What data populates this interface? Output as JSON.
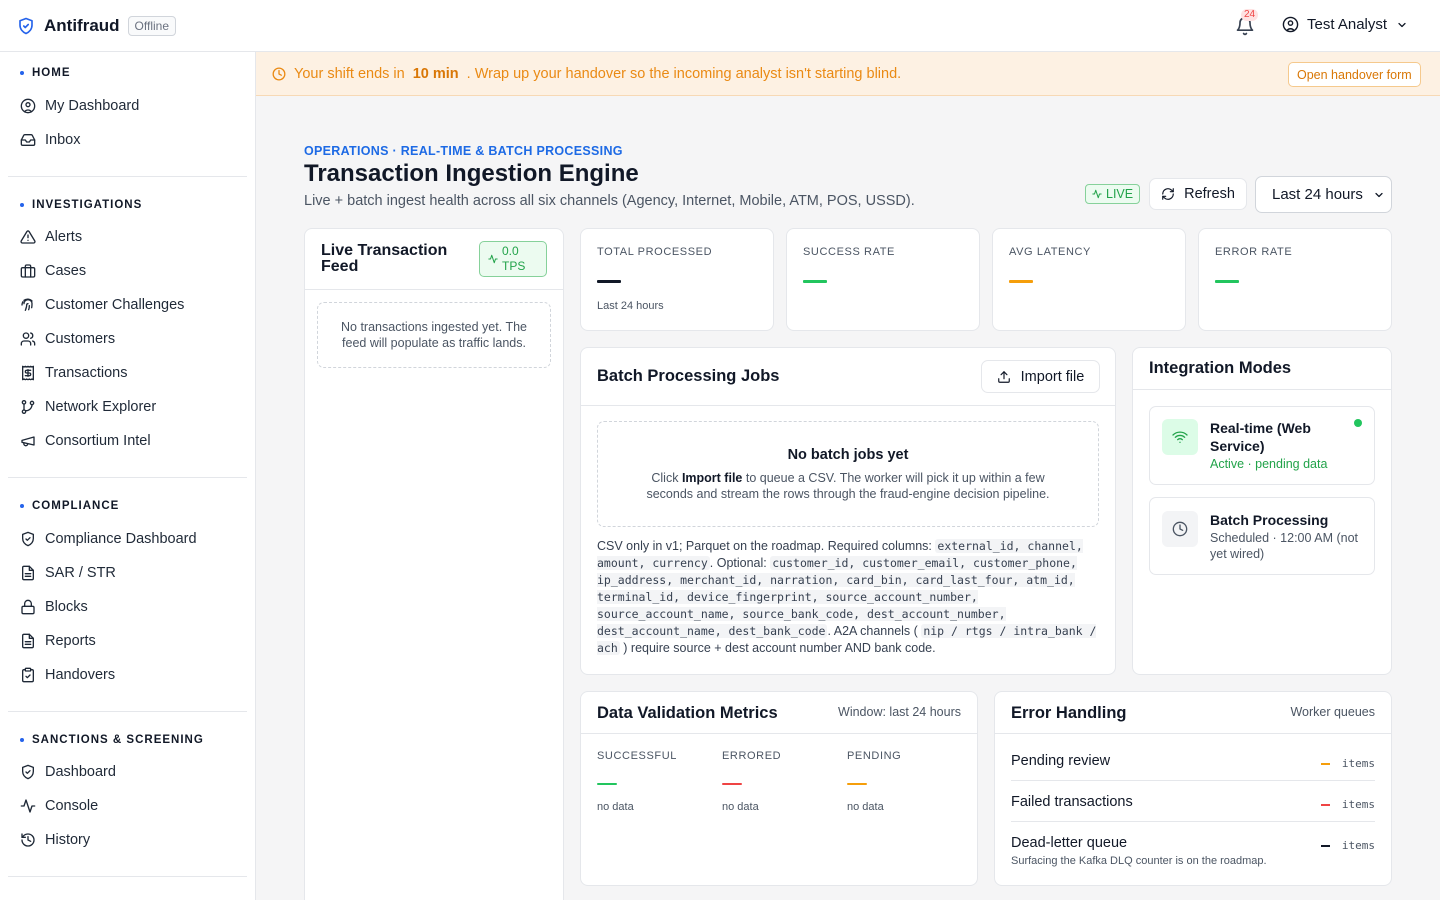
{
  "app": {
    "name": "Antifraud",
    "status_badge": "Offline"
  },
  "topbar": {
    "notifications_count": "24",
    "user_name": "Test Analyst"
  },
  "sidebar": {
    "sections": [
      {
        "heading": "HOME",
        "items": [
          {
            "label": "My Dashboard",
            "icon": "user-circle-icon"
          },
          {
            "label": "Inbox",
            "icon": "inbox-icon"
          }
        ]
      },
      {
        "heading": "INVESTIGATIONS",
        "items": [
          {
            "label": "Alerts",
            "icon": "alert-triangle-icon"
          },
          {
            "label": "Cases",
            "icon": "briefcase-icon"
          },
          {
            "label": "Customer Challenges",
            "icon": "fingerprint-icon"
          },
          {
            "label": "Customers",
            "icon": "users-icon"
          },
          {
            "label": "Transactions",
            "icon": "receipt-icon"
          },
          {
            "label": "Network Explorer",
            "icon": "git-branch-icon"
          },
          {
            "label": "Consortium Intel",
            "icon": "megaphone-icon"
          }
        ]
      },
      {
        "heading": "COMPLIANCE",
        "items": [
          {
            "label": "Compliance Dashboard",
            "icon": "shield-check-icon"
          },
          {
            "label": "SAR / STR",
            "icon": "file-text-icon"
          },
          {
            "label": "Blocks",
            "icon": "lock-icon"
          },
          {
            "label": "Reports",
            "icon": "file-text-icon"
          },
          {
            "label": "Handovers",
            "icon": "clipboard-check-icon"
          }
        ]
      },
      {
        "heading": "SANCTIONS & SCREENING",
        "items": [
          {
            "label": "Dashboard",
            "icon": "shield-check-icon"
          },
          {
            "label": "Console",
            "icon": "activity-icon"
          },
          {
            "label": "History",
            "icon": "history-icon"
          }
        ]
      }
    ]
  },
  "banner": {
    "text_before": "Your shift ends in",
    "time_left": "10 min",
    "text_after": ". Wrap up your handover so the incoming analyst isn't starting blind.",
    "button_label": "Open handover form"
  },
  "header": {
    "eyebrow": "OPERATIONS · REAL-TIME & BATCH PROCESSING",
    "title": "Transaction Ingestion Engine",
    "subtitle": "Live + batch ingest health across all six channels (Agency, Internet, Mobile, ATM, POS, USSD).",
    "live_label": "LIVE",
    "refresh_label": "Refresh",
    "range_selected": "Last 24 hours"
  },
  "feed": {
    "title": "Live Transaction Feed",
    "tps": "0.0 TPS",
    "empty_text": "No transactions ingested yet. The feed will populate as traffic lands."
  },
  "stats": [
    {
      "label": "TOTAL PROCESSED",
      "value": "—",
      "sub": "Last 24 hours",
      "color": "#111827"
    },
    {
      "label": "SUCCESS RATE",
      "value": "—",
      "sub": "",
      "color": "#22c55e"
    },
    {
      "label": "AVG LATENCY",
      "value": "—",
      "sub": "",
      "color": "#f59e0b"
    },
    {
      "label": "ERROR RATE",
      "value": "—",
      "sub": "",
      "color": "#22c55e"
    }
  ],
  "batch": {
    "title": "Batch Processing Jobs",
    "import_label": "Import file",
    "empty_title": "No batch jobs yet",
    "empty_text_before": "Click",
    "empty_text_bold": "Import file",
    "empty_text_after": "to queue a CSV. The worker will pick it up within a few seconds and stream the rows through the fraud-engine decision pipeline.",
    "schema_intro": "CSV only in v1; Parquet on the roadmap. Required columns:",
    "required_columns": "external_id, channel, amount, currency",
    "optional_label": ". Optional:",
    "optional_columns": "customer_id, customer_email, customer_phone, ip_address, merchant_id, narration, card_bin, card_last_four, atm_id, terminal_id, device_fingerprint, source_account_number, source_account_name, source_bank_code, dest_account_number, dest_account_name, dest_bank_code",
    "a2a_label": ". A2A channels (",
    "a2a_channels": "nip / rtgs / intra_bank / ach",
    "a2a_suffix": ") require source + dest account number AND bank code."
  },
  "integration": {
    "title": "Integration Modes",
    "modes": [
      {
        "name": "Real-time (Web Service)",
        "status": "Active · pending data",
        "icon": "wifi-icon",
        "status_color": "#22a34a"
      },
      {
        "name": "Batch Processing",
        "status": "Scheduled · 12:00 AM (not yet wired)",
        "icon": "clock-icon",
        "status_color": "#4b5563"
      }
    ]
  },
  "validation": {
    "title": "Data Validation Metrics",
    "window": "Window: last 24 hours",
    "metrics": [
      {
        "label": "SUCCESSFUL",
        "value": "—",
        "sub": "no data",
        "color": "#22c55e"
      },
      {
        "label": "ERRORED",
        "value": "—",
        "sub": "no data",
        "color": "#ef4444"
      },
      {
        "label": "PENDING",
        "value": "—",
        "sub": "no data",
        "color": "#f59e0b"
      }
    ]
  },
  "error_handling": {
    "title": "Error Handling",
    "subtitle": "Worker queues",
    "rows": [
      {
        "name": "Pending review",
        "count": "—",
        "unit": "items",
        "color": "#f59e0b",
        "note": ""
      },
      {
        "name": "Failed transactions",
        "count": "—",
        "unit": "items",
        "color": "#ef4444",
        "note": ""
      },
      {
        "name": "Dead-letter queue",
        "count": "—",
        "unit": "items",
        "color": "#111827",
        "note": "Surfacing the Kafka DLQ counter is on the roadmap."
      }
    ]
  }
}
